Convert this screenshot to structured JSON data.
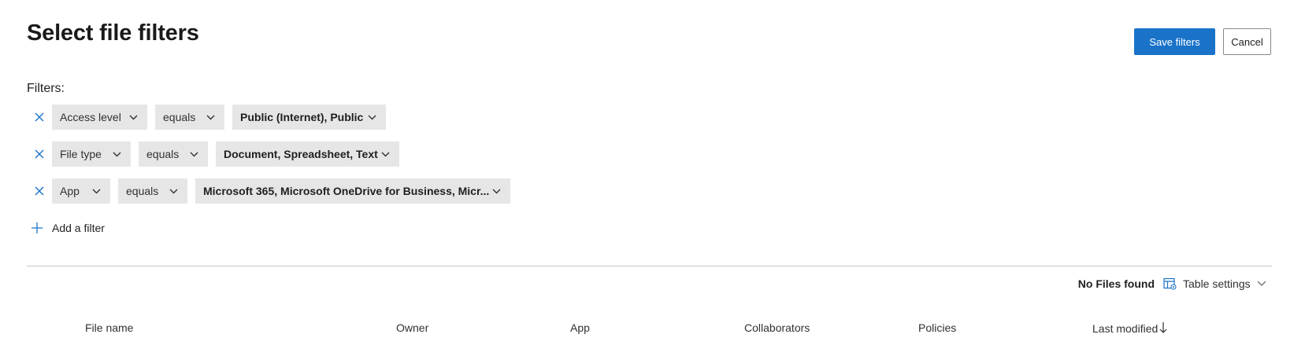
{
  "header": {
    "title": "Select file filters",
    "save_label": "Save filters",
    "cancel_label": "Cancel"
  },
  "filters": {
    "label": "Filters:",
    "rows": [
      {
        "field": "Access level",
        "operator": "equals",
        "value": "Public (Internet), Public"
      },
      {
        "field": "File type",
        "operator": "equals",
        "value": "Document, Spreadsheet, Text"
      },
      {
        "field": "App",
        "operator": "equals",
        "value": "Microsoft 365, Microsoft OneDrive for Business, Micr..."
      }
    ],
    "add_label": "Add a filter"
  },
  "results": {
    "status": "No Files found",
    "table_settings_label": "Table settings"
  },
  "table": {
    "columns": [
      "File name",
      "Owner",
      "App",
      "Collaborators",
      "Policies",
      "Last modified"
    ],
    "sort_column": "Last modified",
    "sort_direction": "descending"
  },
  "colors": {
    "accent": "#1a73c9",
    "chip_bg": "#e6e6e6",
    "divider": "#c8c6c4"
  },
  "icons": {
    "remove": "close-icon",
    "dropdown": "chevron-down-icon",
    "add": "plus-icon",
    "table_settings": "table-settings-icon",
    "sort": "arrow-down-icon"
  }
}
